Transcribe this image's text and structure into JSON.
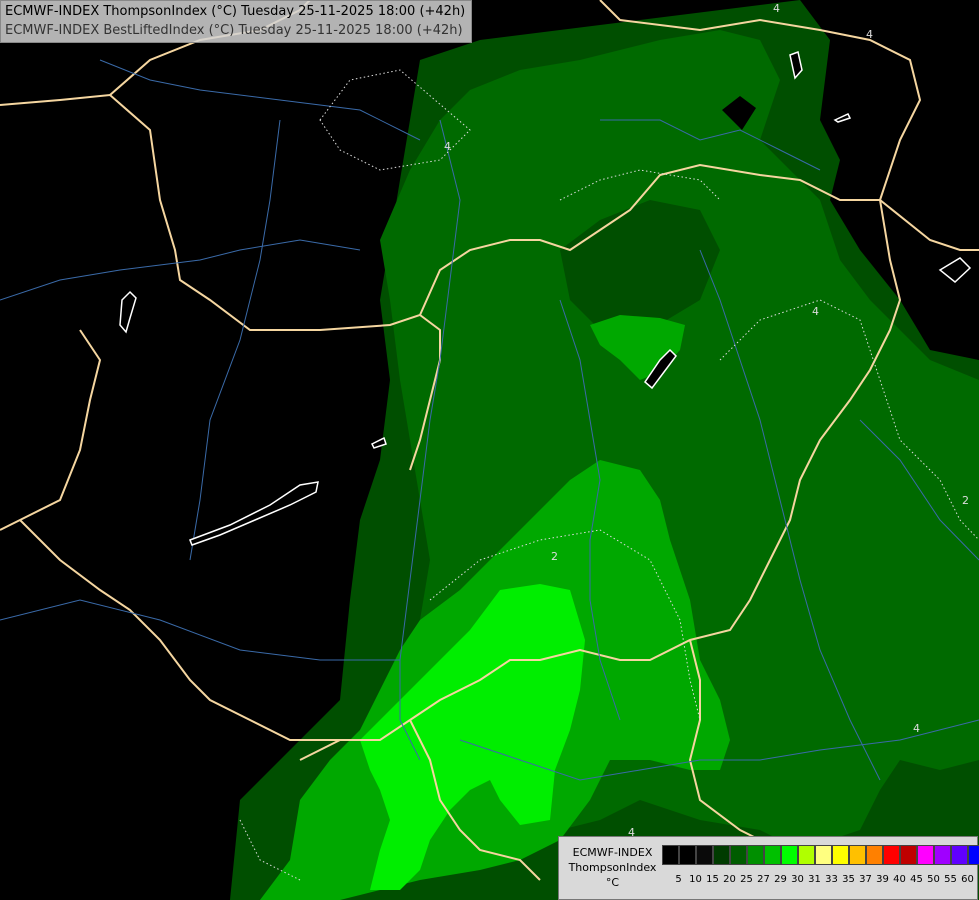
{
  "header": {
    "line1": "ECMWF-INDEX ThompsonIndex (°C) Tuesday 25-11-2025 18:00 (+42h)",
    "line2": "ECMWF-INDEX BestLiftedIndex (°C) Tuesday 25-11-2025 18:00 (+42h)"
  },
  "legend": {
    "title_line1": "ECMWF-INDEX",
    "title_line2": "ThompsonIndex",
    "title_line3": "°C",
    "ticks": [
      "5",
      "10",
      "15",
      "20",
      "25",
      "27",
      "29",
      "30",
      "31",
      "33",
      "35",
      "37",
      "39",
      "40",
      "45",
      "50",
      "55",
      "60"
    ],
    "colors": [
      "#000000",
      "#000000",
      "#0a0a0a",
      "#003b00",
      "#005c00",
      "#008f00",
      "#00c000",
      "#00ff00",
      "#b0ff00",
      "#ffff80",
      "#ffff00",
      "#ffc000",
      "#ff8000",
      "#ff0000",
      "#c00000",
      "#ff00ff",
      "#a000ff",
      "#6000ff",
      "#0000ff"
    ]
  },
  "contour_labels": [
    "4",
    "4",
    "4",
    "4",
    "2",
    "2",
    "4",
    "4"
  ],
  "map_colors": {
    "background": "#000000",
    "zone_dark": "#004f00",
    "zone_mid": "#006a00",
    "zone_light": "#00a800",
    "zone_bright": "#00ee00",
    "border": "#f5d6a0",
    "river": "#3a6aa8"
  }
}
